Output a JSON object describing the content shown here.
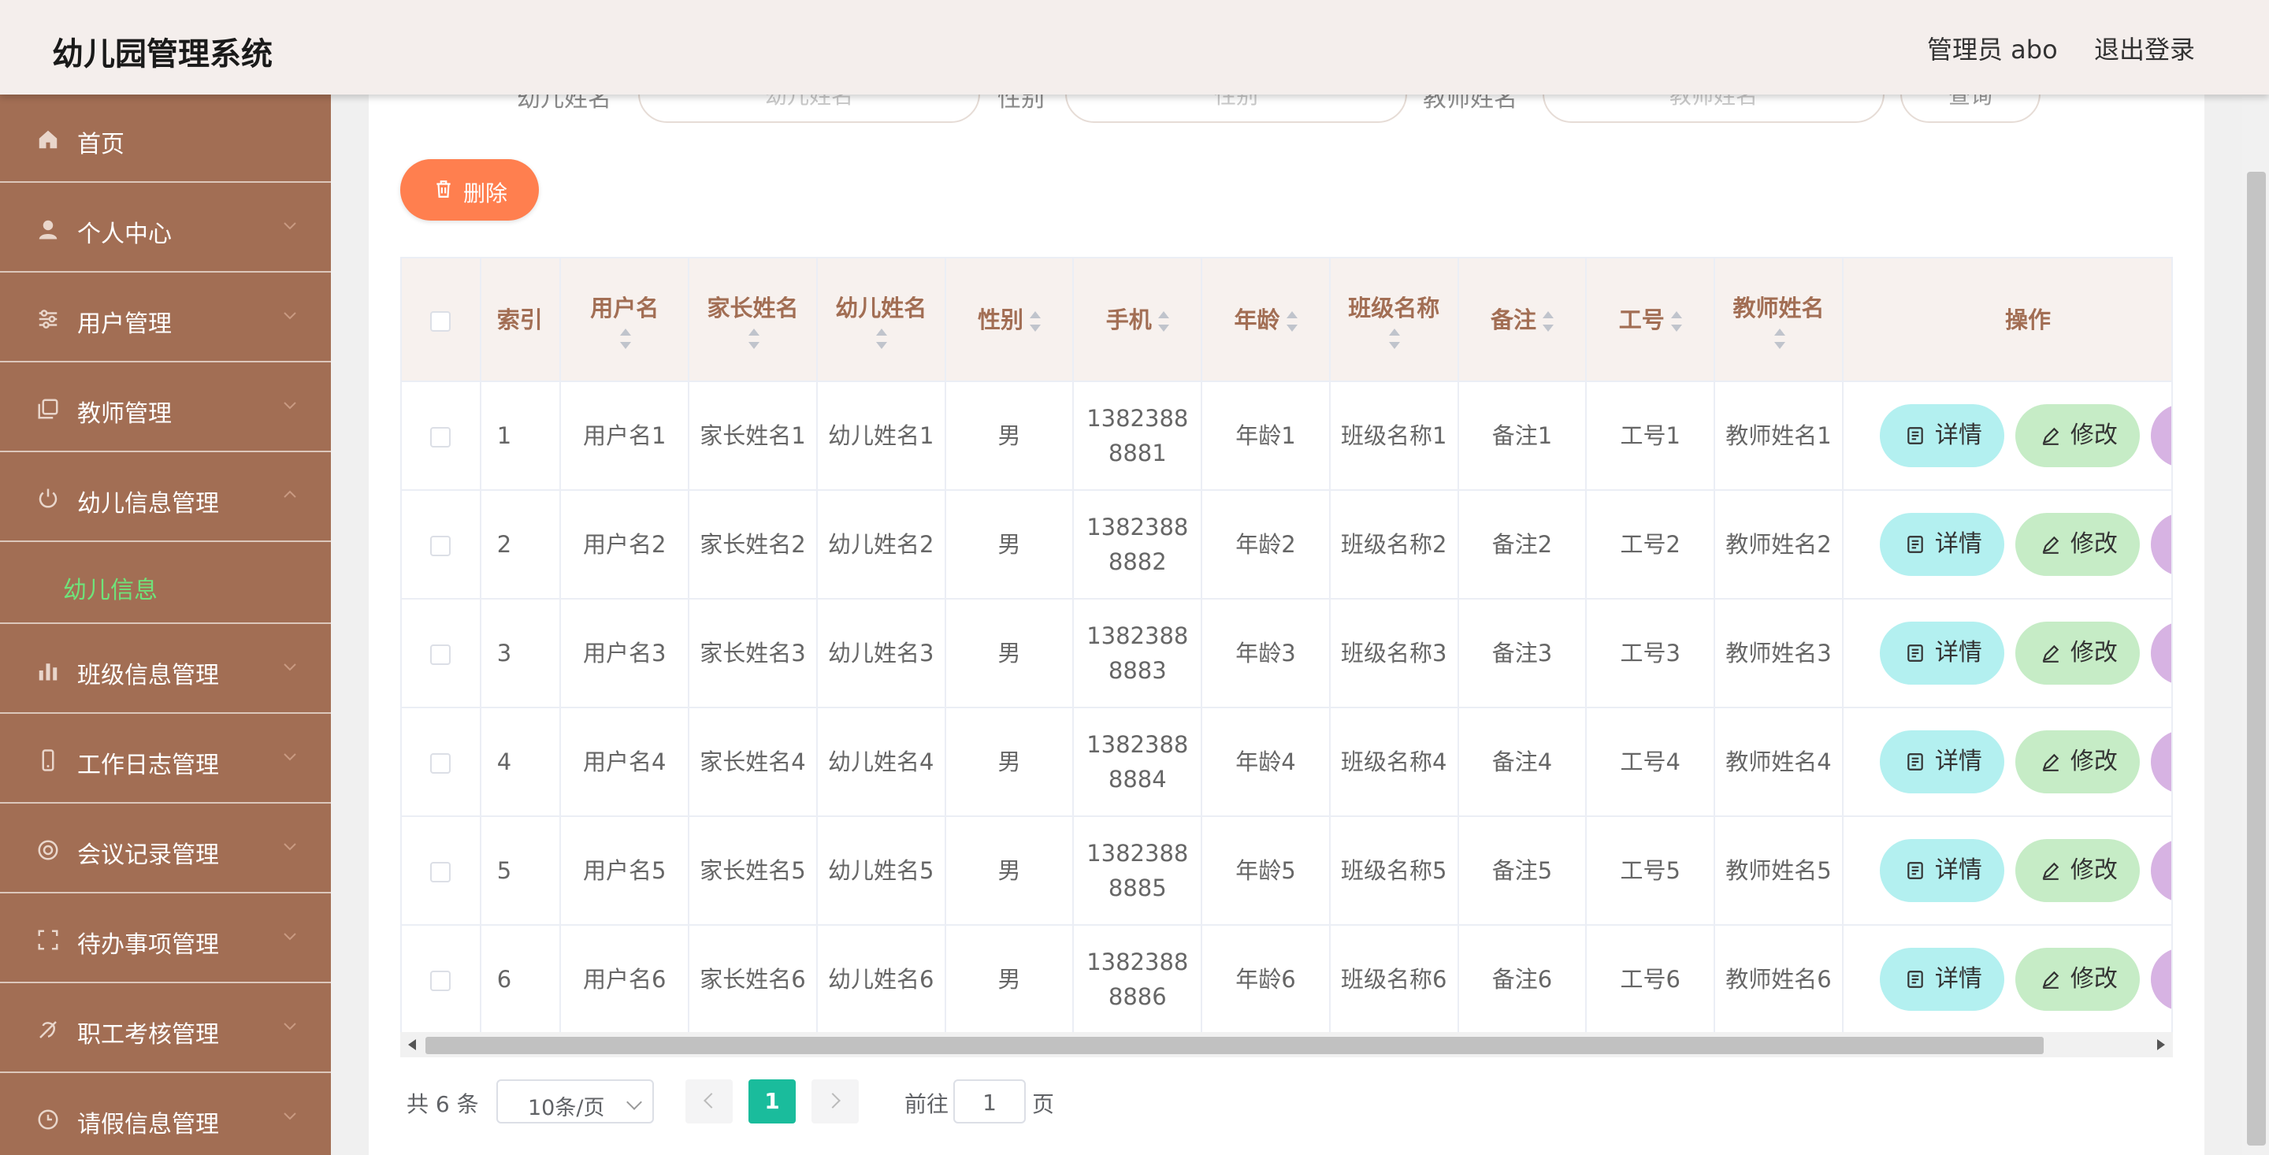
{
  "header": {
    "title": "幼儿园管理系统",
    "user": "管理员 abo",
    "logout": "退出登录"
  },
  "sidebar": {
    "items": [
      {
        "label": "首页",
        "icon": "home-icon"
      },
      {
        "label": "个人中心",
        "icon": "user-icon"
      },
      {
        "label": "用户管理",
        "icon": "sliders-icon"
      },
      {
        "label": "教师管理",
        "icon": "copy-icon"
      },
      {
        "label": "幼儿信息管理",
        "icon": "power-icon"
      },
      {
        "label": "班级信息管理",
        "icon": "bar-chart-icon"
      },
      {
        "label": "工作日志管理",
        "icon": "phone-icon"
      },
      {
        "label": "会议记录管理",
        "icon": "target-icon"
      },
      {
        "label": "待办事项管理",
        "icon": "scan-icon"
      },
      {
        "label": "职工考核管理",
        "icon": "slash-icon"
      },
      {
        "label": "请假信息管理",
        "icon": "clock-icon"
      }
    ],
    "submenu": {
      "label": "幼儿信息",
      "color": "#6fe37a"
    }
  },
  "search": {
    "fields": [
      {
        "label": "幼儿姓名",
        "placeholder": "幼儿姓名"
      },
      {
        "label": "性别",
        "placeholder": "性别"
      },
      {
        "label": "教师姓名",
        "placeholder": "教师姓名"
      }
    ],
    "button": "查询"
  },
  "toolbar": {
    "delete": "删除"
  },
  "table": {
    "columns": {
      "index": "索引",
      "username": "用户名",
      "parent": "家长姓名",
      "child": "幼儿姓名",
      "gender": "性别",
      "phone": "手机",
      "age": "年龄",
      "class": "班级名称",
      "note": "备注",
      "job_no": "工号",
      "teacher": "教师姓名",
      "actions": "操作"
    },
    "rows": [
      {
        "index": "1",
        "username": "用户名1",
        "parent": "家长姓名1",
        "child": "幼儿姓名1",
        "gender": "男",
        "phone": "13823888881",
        "age": "年龄1",
        "class": "班级名称1",
        "note": "备注1",
        "job_no": "工号1",
        "teacher": "教师姓名1"
      },
      {
        "index": "2",
        "username": "用户名2",
        "parent": "家长姓名2",
        "child": "幼儿姓名2",
        "gender": "男",
        "phone": "13823888882",
        "age": "年龄2",
        "class": "班级名称2",
        "note": "备注2",
        "job_no": "工号2",
        "teacher": "教师姓名2"
      },
      {
        "index": "3",
        "username": "用户名3",
        "parent": "家长姓名3",
        "child": "幼儿姓名3",
        "gender": "男",
        "phone": "13823888883",
        "age": "年龄3",
        "class": "班级名称3",
        "note": "备注3",
        "job_no": "工号3",
        "teacher": "教师姓名3"
      },
      {
        "index": "4",
        "username": "用户名4",
        "parent": "家长姓名4",
        "child": "幼儿姓名4",
        "gender": "男",
        "phone": "13823888884",
        "age": "年龄4",
        "class": "班级名称4",
        "note": "备注4",
        "job_no": "工号4",
        "teacher": "教师姓名4"
      },
      {
        "index": "5",
        "username": "用户名5",
        "parent": "家长姓名5",
        "child": "幼儿姓名5",
        "gender": "男",
        "phone": "13823888885",
        "age": "年龄5",
        "class": "班级名称5",
        "note": "备注5",
        "job_no": "工号5",
        "teacher": "教师姓名5"
      },
      {
        "index": "6",
        "username": "用户名6",
        "parent": "家长姓名6",
        "child": "幼儿姓名6",
        "gender": "男",
        "phone": "13823888886",
        "age": "年龄6",
        "class": "班级名称6",
        "note": "备注6",
        "job_no": "工号6",
        "teacher": "教师姓名6"
      }
    ],
    "row_actions": {
      "detail": "详情",
      "edit": "修改"
    }
  },
  "pagination": {
    "total": "共 6 条",
    "page_size": "10条/页",
    "current": "1",
    "goto_prefix": "前往",
    "goto_value": "1",
    "goto_suffix": "页"
  },
  "colors": {
    "sidebar_bg": "#a26e54",
    "header_bg": "#f4eeec",
    "delete_button": "#ff7f4f",
    "detail_button": "#b3f0f0",
    "edit_button": "#c6ecc6",
    "remove_button": "#d7b3e3",
    "current_page": "#1abc9c",
    "table_header_text": "#a26e54"
  }
}
